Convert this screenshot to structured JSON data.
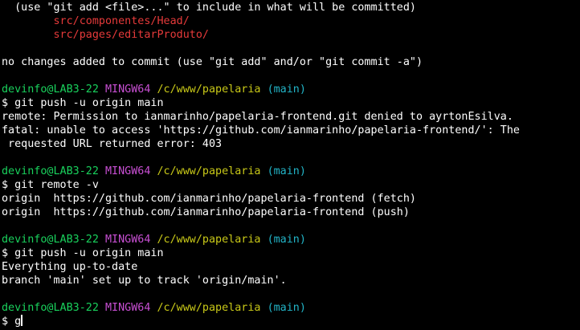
{
  "colors": {
    "background": "#000000",
    "text": "#ffffff",
    "untracked_file": "#e63a3a",
    "user_host": "#19d15c",
    "env": "#c84fd3",
    "path": "#c9c918",
    "branch": "#22b5c8"
  },
  "hint": "  (use \"git add <file>...\" to include in what will be committed)",
  "files": [
    "        src/componentes/Head/",
    "        src/pages/editarProduto/"
  ],
  "no_changes": "no changes added to commit (use \"git add\" and/or \"git commit -a\")",
  "prompt": {
    "user_host": "devinfo@LAB3-22",
    "env": "MINGW64",
    "path": "/c/www/papelaria",
    "branch": "(main)",
    "symbol": "$"
  },
  "blocks": [
    {
      "command": "git push -u origin main",
      "output": [
        "remote: Permission to ianmarinho/papelaria-frontend.git denied to ayrtonEsilva.",
        "fatal: unable to access 'https://github.com/ianmarinho/papelaria-frontend/': The",
        " requested URL returned error: 403"
      ]
    },
    {
      "command": "git remote -v",
      "output": [
        "origin  https://github.com/ianmarinho/papelaria-frontend (fetch)",
        "origin  https://github.com/ianmarinho/papelaria-frontend (push)"
      ]
    },
    {
      "command": "git push -u origin main",
      "output": [
        "Everything up-to-date",
        "branch 'main' set up to track 'origin/main'."
      ]
    }
  ],
  "current_input": "g"
}
